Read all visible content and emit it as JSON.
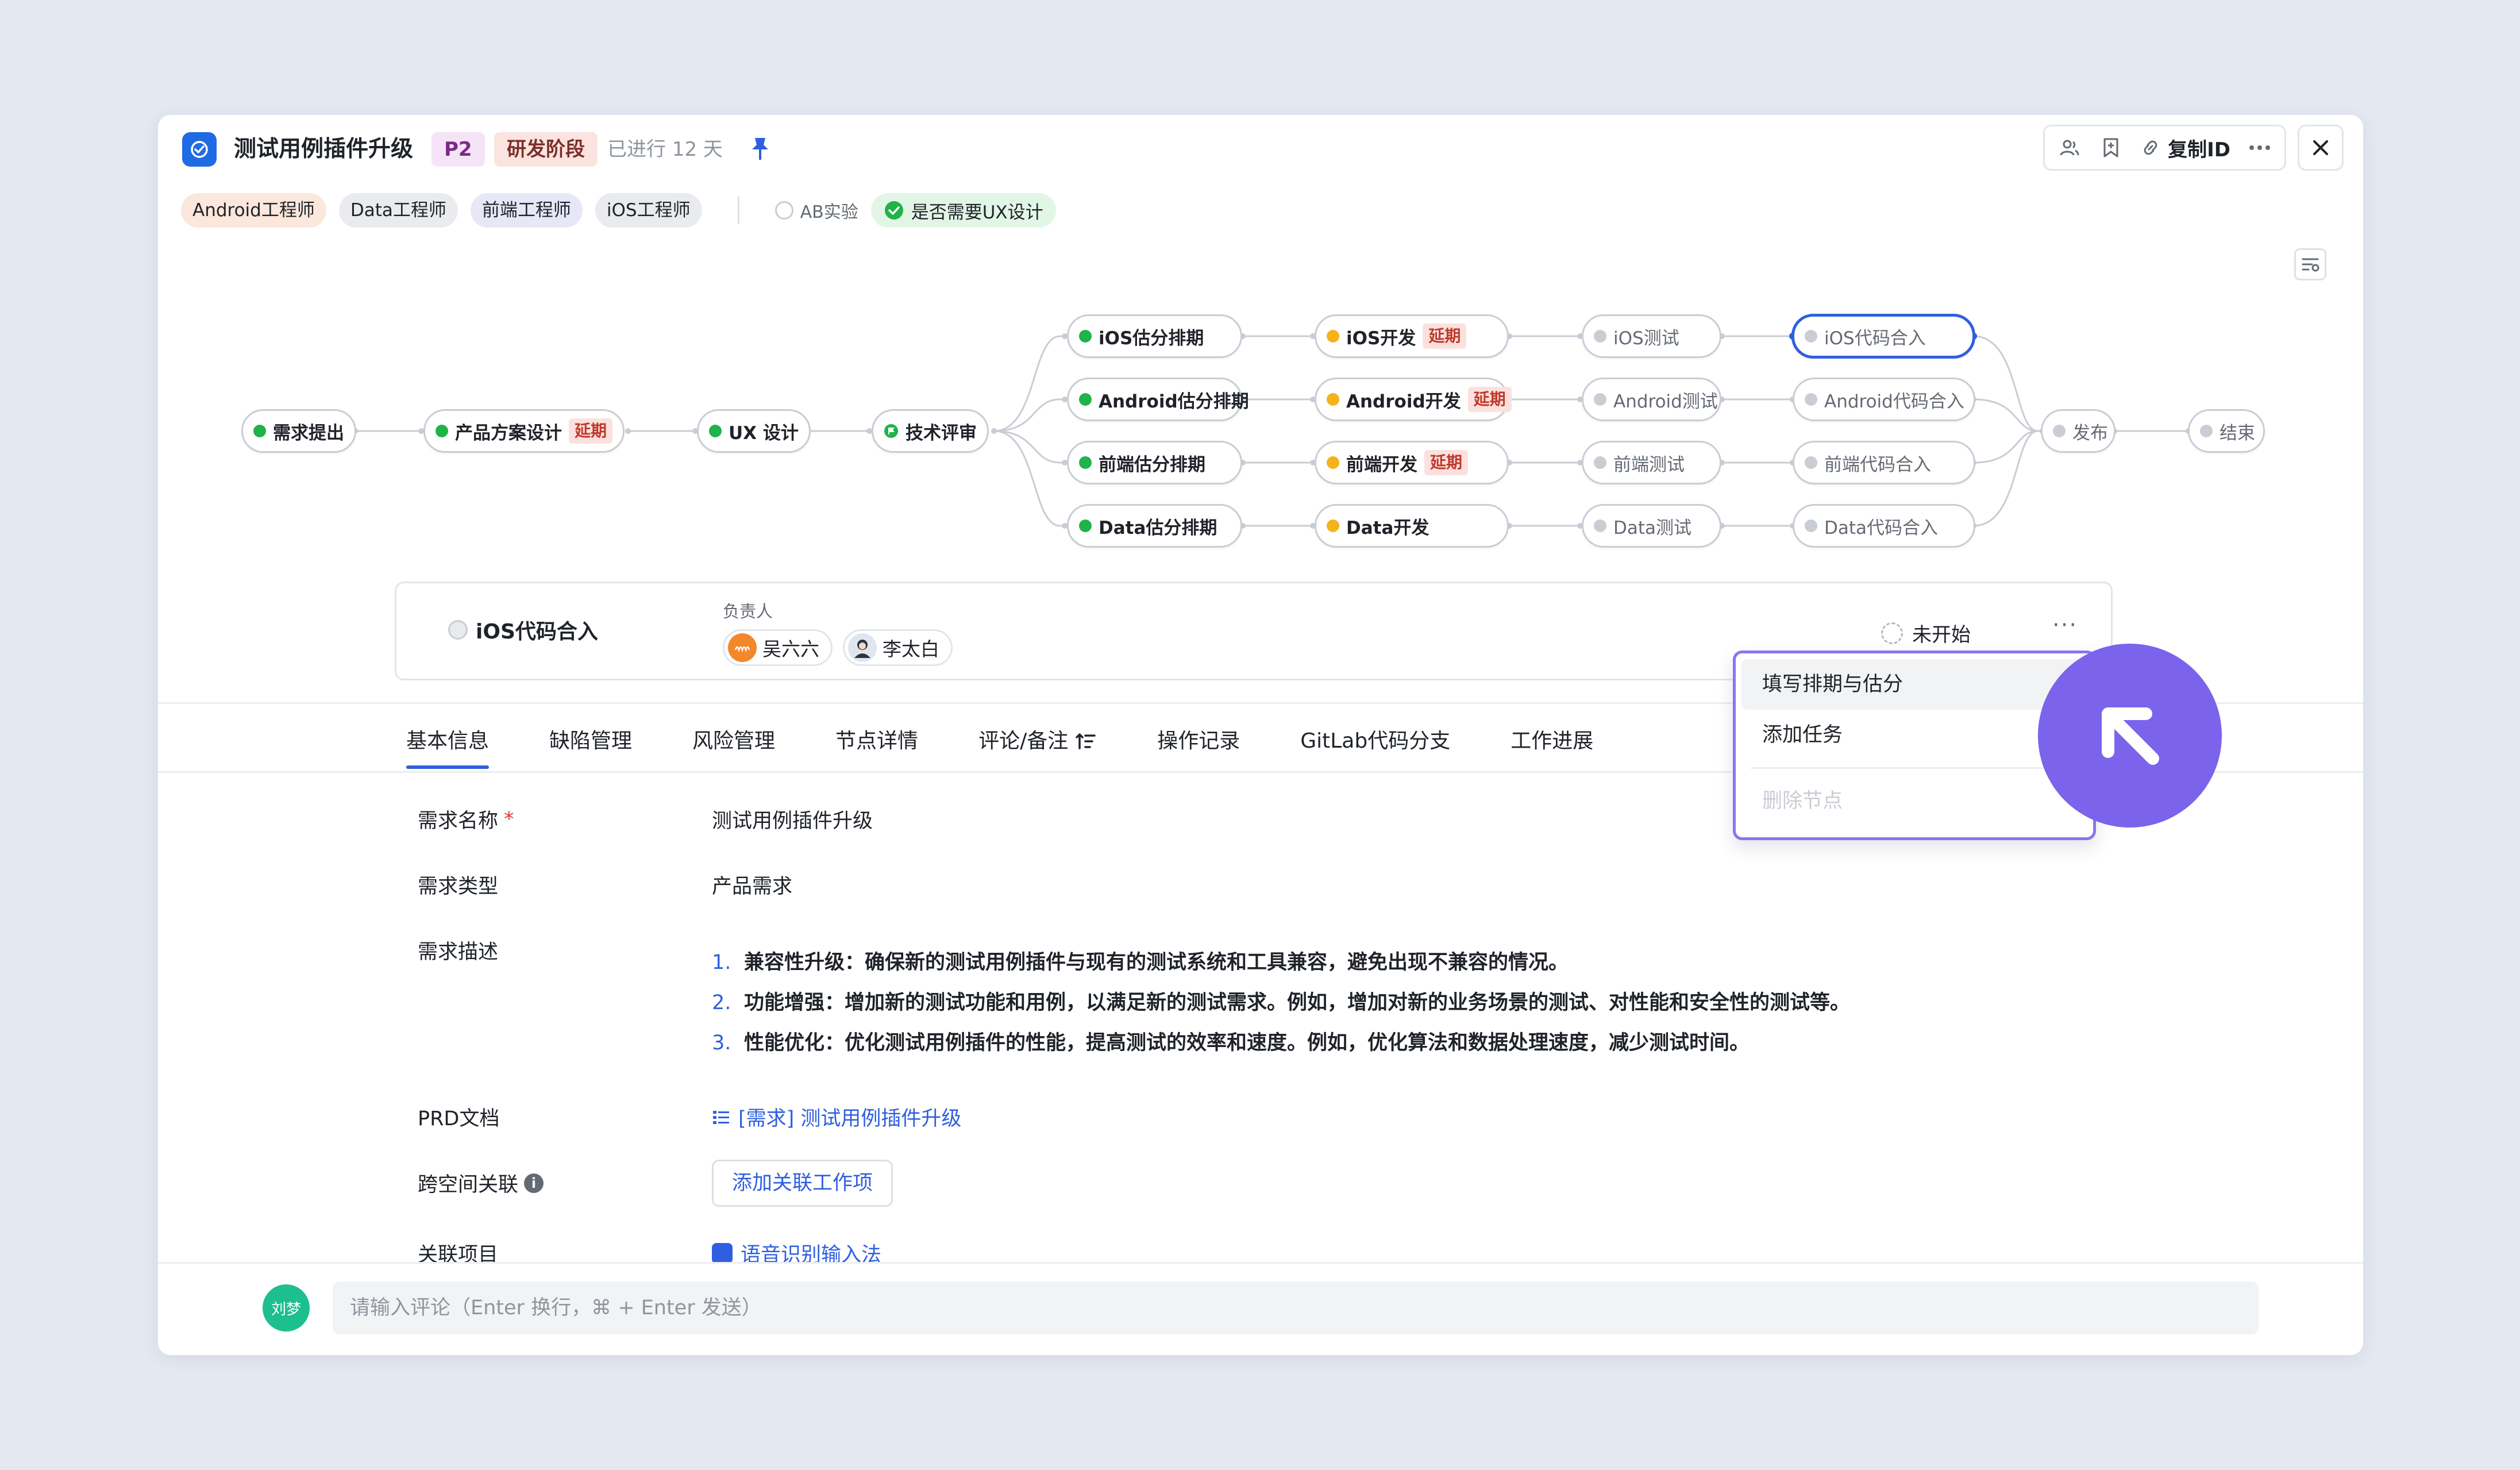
{
  "header": {
    "title": "测试用例插件升级",
    "priority": "P2",
    "stage": "研发阶段",
    "elapsed": "已进行 12 天",
    "copy_id_label": "复制ID",
    "more_label": "···"
  },
  "role_tags": [
    "Android工程师",
    "Data工程师",
    "前端工程师",
    "iOS工程师"
  ],
  "checks": {
    "ab_label": "AB实验",
    "ux_label": "是否需要UX设计"
  },
  "flow": {
    "late_label": "延期",
    "nodes": {
      "req": "需求提出",
      "prod": "产品方案设计",
      "ux": "UX 设计",
      "tech": "技术评审",
      "ios_est": "iOS估分排期",
      "and_est": "Android估分排期",
      "fe_est": "前端估分排期",
      "data_est": "Data估分排期",
      "ios_dev": "iOS开发",
      "and_dev": "Android开发",
      "fe_dev": "前端开发",
      "data_dev": "Data开发",
      "ios_test": "iOS测试",
      "and_test": "Android测试",
      "fe_test": "前端测试",
      "data_test": "Data测试",
      "ios_merge": "iOS代码合入",
      "and_merge": "Android代码合入",
      "fe_merge": "前端代码合入",
      "data_merge": "Data代码合入",
      "release": "发布",
      "end": "结束"
    }
  },
  "node_panel": {
    "title": "iOS代码合入",
    "owner_label": "负责人",
    "owners": [
      "吴六六",
      "李太白"
    ],
    "status": "未开始",
    "more": "···"
  },
  "menu": {
    "items": [
      "填写排期与估分",
      "添加任务",
      "删除节点"
    ]
  },
  "tabs": [
    "基本信息",
    "缺陷管理",
    "风险管理",
    "节点详情",
    "评论/备注",
    "操作记录",
    "GitLab代码分支",
    "工作进展"
  ],
  "form": {
    "name_label": "需求名称",
    "name_value": "测试用例插件升级",
    "type_label": "需求类型",
    "type_value": "产品需求",
    "desc_label": "需求描述",
    "desc_items": [
      "兼容性升级：确保新的测试用例插件与现有的测试系统和工具兼容，避免出现不兼容的情况。",
      "功能增强：增加新的测试功能和用例，以满足新的测试需求。例如，增加对新的业务场景的测试、对性能和安全性的测试等。",
      "性能优化：优化测试用例插件的性能，提高测试的效率和速度。例如，优化算法和数据处理速度，减少测试时间。"
    ],
    "prd_label": "PRD文档",
    "prd_link": "[需求] 测试用例插件升级",
    "cross_label": "跨空间关联",
    "cross_button": "添加关联工作项",
    "project_label": "关联项目",
    "project_link": "语音识别输入法"
  },
  "comment": {
    "avatar_text": "刘梦",
    "placeholder": "请输入评论（Enter 换行，⌘ + Enter 发送）"
  },
  "colors": {
    "accent": "#2f5fe0",
    "done": "#1fb34a",
    "doing": "#f5b21a",
    "menu_border": "#8c74ee",
    "cursor": "#7b63ec"
  }
}
